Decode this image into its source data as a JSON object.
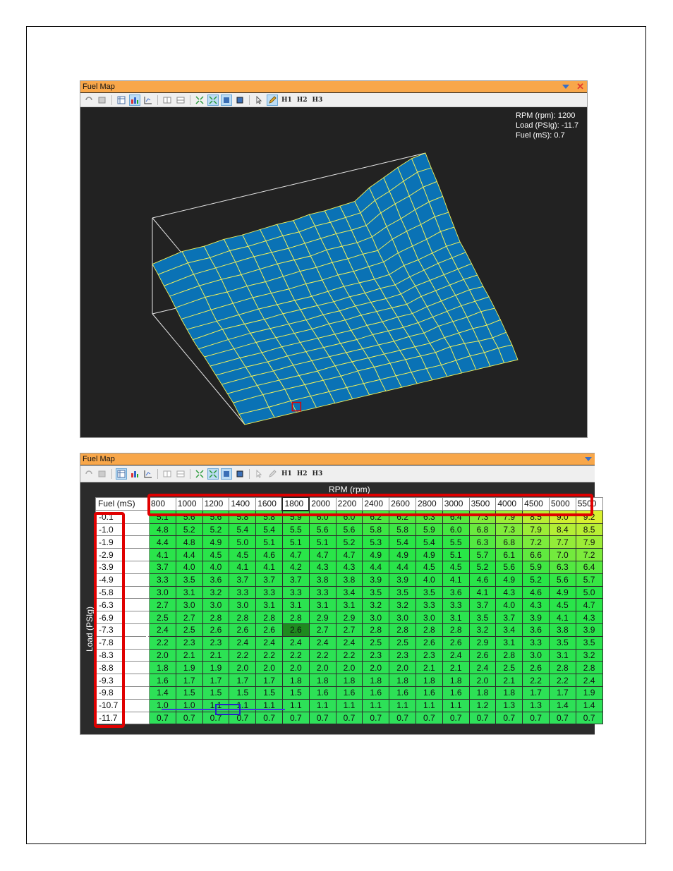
{
  "top_panel": {
    "title": "Fuel Map",
    "toolbar_labels": [
      "H1",
      "H2",
      "H3"
    ],
    "readout": {
      "rpm": "RPM (rpm): 1200",
      "load": "Load (PSIg): -11.7",
      "fuel": "Fuel (mS): 0.7"
    }
  },
  "bottom_panel": {
    "title": "Fuel Map",
    "toolbar_labels": [
      "H1",
      "H2",
      "H3"
    ],
    "x_axis_title": "RPM (rpm)",
    "y_axis_title": "Load (PSIg)",
    "corner_label": "Fuel (mS)",
    "selected_column": "1800",
    "selected_row": "-7.3"
  },
  "chart_data": {
    "type": "table",
    "x_label": "RPM (rpm)",
    "y_label": "Load (PSIg)",
    "value_label": "Fuel (mS)",
    "rpm": [
      "800",
      "1000",
      "1200",
      "1400",
      "1600",
      "1800",
      "2000",
      "2200",
      "2400",
      "2600",
      "2800",
      "3000",
      "3500",
      "4000",
      "4500",
      "5000",
      "5500"
    ],
    "load": [
      "-0.1",
      "-1.0",
      "-1.9",
      "-2.9",
      "-3.9",
      "-4.9",
      "-5.8",
      "-6.3",
      "-6.9",
      "-7.3",
      "-7.8",
      "-8.3",
      "-8.8",
      "-9.3",
      "-9.8",
      "-10.7",
      "-11.7"
    ],
    "values": [
      [
        "5.1",
        "5.6",
        "5.6",
        "5.8",
        "5.8",
        "5.9",
        "6.0",
        "6.0",
        "6.2",
        "6.2",
        "6.3",
        "6.4",
        "7.3",
        "7.9",
        "8.5",
        "9.0",
        "9.2"
      ],
      [
        "4.8",
        "5.2",
        "5.2",
        "5.4",
        "5.4",
        "5.5",
        "5.6",
        "5.6",
        "5.8",
        "5.8",
        "5.9",
        "6.0",
        "6.8",
        "7.3",
        "7.9",
        "8.4",
        "8.5"
      ],
      [
        "4.4",
        "4.8",
        "4.9",
        "5.0",
        "5.1",
        "5.1",
        "5.1",
        "5.2",
        "5.3",
        "5.4",
        "5.4",
        "5.5",
        "6.3",
        "6.8",
        "7.2",
        "7.7",
        "7.9"
      ],
      [
        "4.1",
        "4.4",
        "4.5",
        "4.5",
        "4.6",
        "4.7",
        "4.7",
        "4.7",
        "4.9",
        "4.9",
        "4.9",
        "5.1",
        "5.7",
        "6.1",
        "6.6",
        "7.0",
        "7.2"
      ],
      [
        "3.7",
        "4.0",
        "4.0",
        "4.1",
        "4.1",
        "4.2",
        "4.3",
        "4.3",
        "4.4",
        "4.4",
        "4.5",
        "4.5",
        "5.2",
        "5.6",
        "5.9",
        "6.3",
        "6.4"
      ],
      [
        "3.3",
        "3.5",
        "3.6",
        "3.7",
        "3.7",
        "3.7",
        "3.8",
        "3.8",
        "3.9",
        "3.9",
        "4.0",
        "4.1",
        "4.6",
        "4.9",
        "5.2",
        "5.6",
        "5.7"
      ],
      [
        "3.0",
        "3.1",
        "3.2",
        "3.3",
        "3.3",
        "3.3",
        "3.3",
        "3.4",
        "3.5",
        "3.5",
        "3.5",
        "3.6",
        "4.1",
        "4.3",
        "4.6",
        "4.9",
        "5.0"
      ],
      [
        "2.7",
        "3.0",
        "3.0",
        "3.0",
        "3.1",
        "3.1",
        "3.1",
        "3.1",
        "3.2",
        "3.2",
        "3.3",
        "3.3",
        "3.7",
        "4.0",
        "4.3",
        "4.5",
        "4.7"
      ],
      [
        "2.5",
        "2.7",
        "2.8",
        "2.8",
        "2.8",
        "2.8",
        "2.9",
        "2.9",
        "3.0",
        "3.0",
        "3.0",
        "3.1",
        "3.5",
        "3.7",
        "3.9",
        "4.1",
        "4.3"
      ],
      [
        "2.4",
        "2.5",
        "2.6",
        "2.6",
        "2.6",
        "2.6",
        "2.7",
        "2.7",
        "2.8",
        "2.8",
        "2.8",
        "2.8",
        "3.2",
        "3.4",
        "3.6",
        "3.8",
        "3.9"
      ],
      [
        "2.2",
        "2.3",
        "2.3",
        "2.4",
        "2.4",
        "2.4",
        "2.4",
        "2.4",
        "2.5",
        "2.5",
        "2.6",
        "2.6",
        "2.9",
        "3.1",
        "3.3",
        "3.5",
        "3.5"
      ],
      [
        "2.0",
        "2.1",
        "2.1",
        "2.2",
        "2.2",
        "2.2",
        "2.2",
        "2.2",
        "2.3",
        "2.3",
        "2.3",
        "2.4",
        "2.6",
        "2.8",
        "3.0",
        "3.1",
        "3.2"
      ],
      [
        "1.8",
        "1.9",
        "1.9",
        "2.0",
        "2.0",
        "2.0",
        "2.0",
        "2.0",
        "2.0",
        "2.0",
        "2.1",
        "2.1",
        "2.4",
        "2.5",
        "2.6",
        "2.8",
        "2.8"
      ],
      [
        "1.6",
        "1.7",
        "1.7",
        "1.7",
        "1.7",
        "1.8",
        "1.8",
        "1.8",
        "1.8",
        "1.8",
        "1.8",
        "1.8",
        "2.0",
        "2.1",
        "2.2",
        "2.2",
        "2.4"
      ],
      [
        "1.4",
        "1.5",
        "1.5",
        "1.5",
        "1.5",
        "1.5",
        "1.6",
        "1.6",
        "1.6",
        "1.6",
        "1.6",
        "1.6",
        "1.8",
        "1.8",
        "1.7",
        "1.7",
        "1.9"
      ],
      [
        "1.0",
        "1.0",
        "1.1",
        "1.1",
        "1.1",
        "1.1",
        "1.1",
        "1.1",
        "1.1",
        "1.1",
        "1.1",
        "1.1",
        "1.2",
        "1.3",
        "1.3",
        "1.4",
        "1.4"
      ],
      [
        "0.7",
        "0.7",
        "0.7",
        "0.7",
        "0.7",
        "0.7",
        "0.7",
        "0.7",
        "0.7",
        "0.7",
        "0.7",
        "0.7",
        "0.7",
        "0.7",
        "0.7",
        "0.7",
        "0.7"
      ]
    ]
  },
  "colors": {
    "titlebar": "#f8a74a",
    "surface": "#0a72b5",
    "mesh": "#f2f25a",
    "highlight_box": "#e00000",
    "selected_cell": "#1f8a1f"
  }
}
